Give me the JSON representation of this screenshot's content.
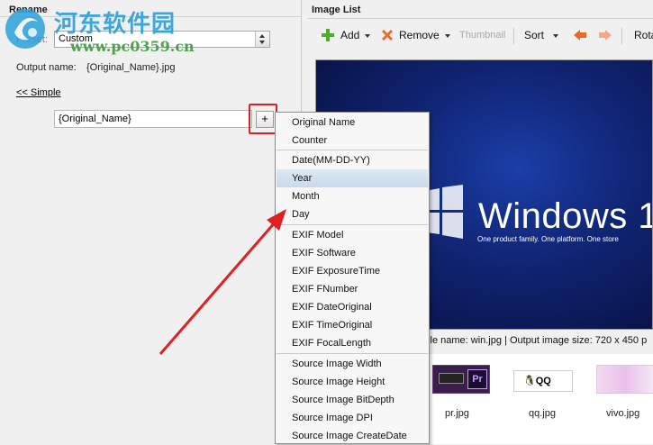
{
  "watermark": {
    "title": "河东软件园",
    "url": "www.pc0359.cn"
  },
  "rename_panel": {
    "title": "Rename",
    "preset_label": "Preset:",
    "preset_value": "Custom",
    "output_label": "Output name:",
    "output_value": "{Original_Name}.jpg",
    "simple_link": "<< Simple",
    "name_field_value": "{Original_Name}",
    "insert_button": "+"
  },
  "image_list": {
    "title": "Image List",
    "toolbar": {
      "add": "Add",
      "remove": "Remove",
      "thumbnail": "Thumbnail",
      "sort": "Sort",
      "rotate": "Rota"
    },
    "preview": {
      "windows_text": "Windows 1",
      "tagline": "One product family. One platform. One store"
    },
    "status": "file name: win.jpg | Output image size: 720 x 450 p",
    "thumbnails": [
      {
        "label": "pr.jpg"
      },
      {
        "label": "qq.jpg"
      },
      {
        "label": "vivo.jpg"
      }
    ]
  },
  "insert_menu": {
    "highlighted": "Year",
    "groups": [
      [
        "Original Name",
        "Counter"
      ],
      [
        "Date(MM-DD-YY)",
        "Year",
        "Month",
        "Day"
      ],
      [
        "EXIF Model",
        "EXIF Software",
        "EXIF ExposureTime",
        "EXIF FNumber",
        "EXIF DateOriginal",
        "EXIF TimeOriginal",
        "EXIF FocalLength"
      ],
      [
        "Source Image Width",
        "Source Image Height",
        "Source Image BitDepth",
        "Source Image DPI",
        "Source Image CreateDate"
      ]
    ]
  },
  "colors": {
    "annotation": "#e02020",
    "highlight": "#c9d9ea",
    "watermark_blue": "#2aa0d8",
    "watermark_green": "#3b9a3b"
  }
}
